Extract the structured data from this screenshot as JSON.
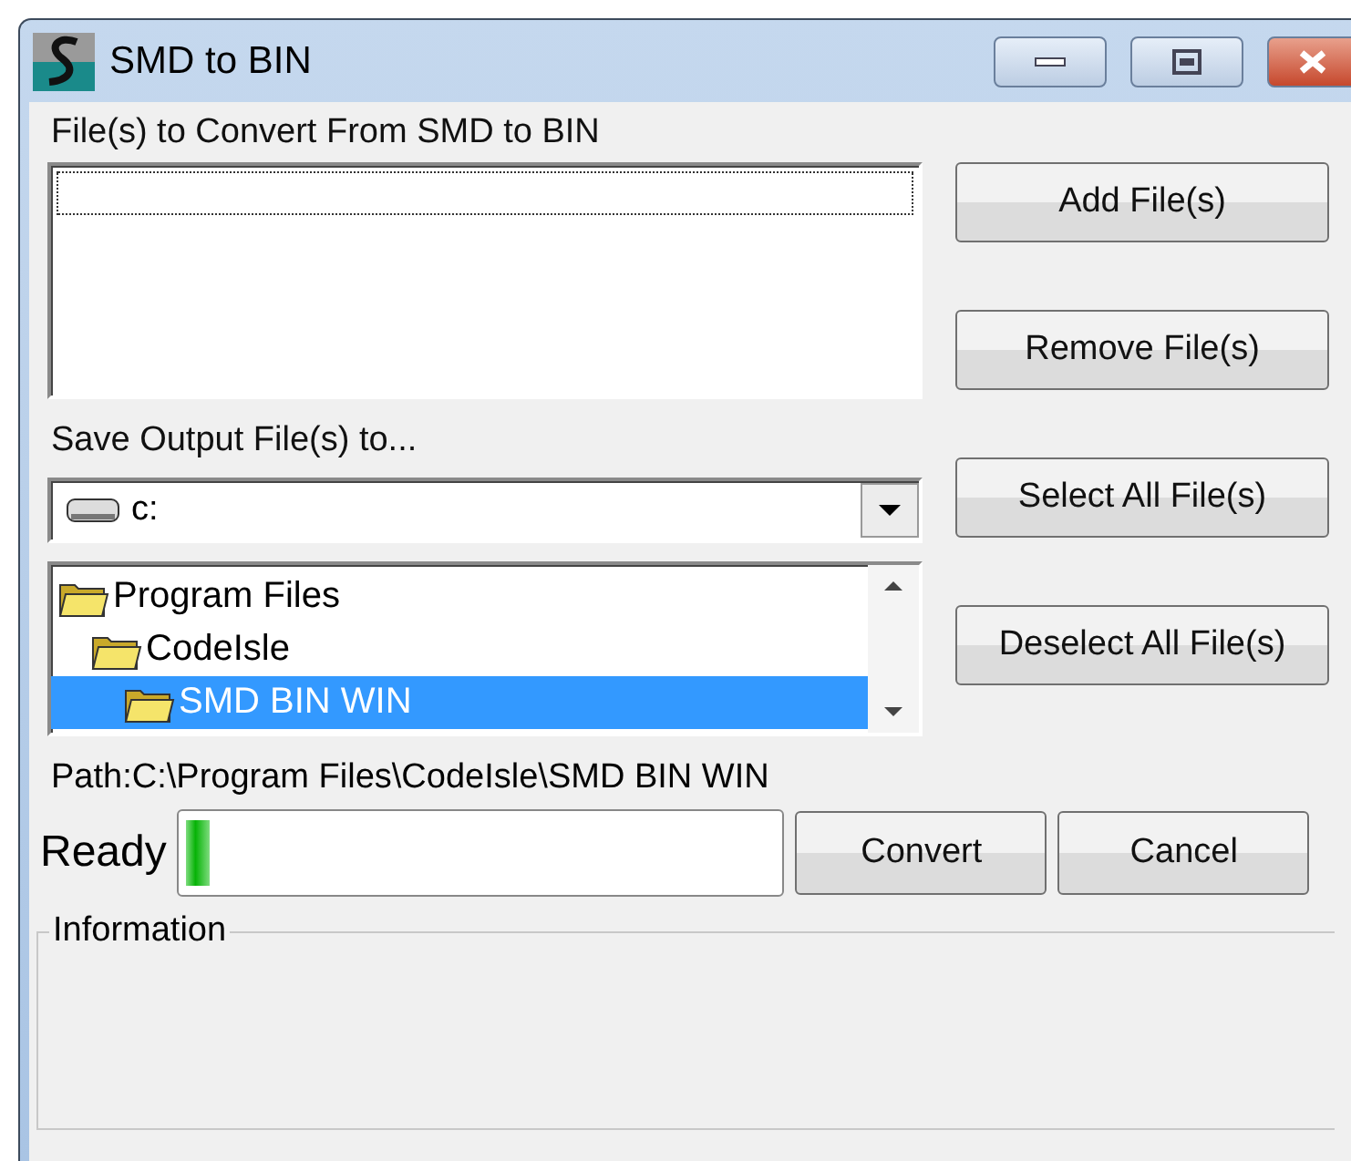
{
  "window": {
    "title": "SMD to BIN"
  },
  "files_label": "File(s) to Convert From SMD to BIN",
  "save_label": "Save Output File(s) to...",
  "drive": {
    "value": "c:"
  },
  "folders": [
    {
      "label": "Program Files",
      "selected": false,
      "children": [
        {
          "label": "CodeIsle",
          "selected": false,
          "children": [
            {
              "label": "SMD BIN WIN",
              "selected": true
            }
          ]
        }
      ]
    }
  ],
  "buttons": [
    "Add File(s)",
    "Remove File(s)",
    "Select All File(s)",
    "Deselect All File(s)"
  ],
  "path": "Path:C:\\Program Files\\CodeIsle\\SMD BIN WIN",
  "status": "Ready",
  "progress": {
    "level": 0.04
  },
  "actions": [
    "Convert",
    "Cancel"
  ],
  "information": {
    "title": "Information"
  }
}
